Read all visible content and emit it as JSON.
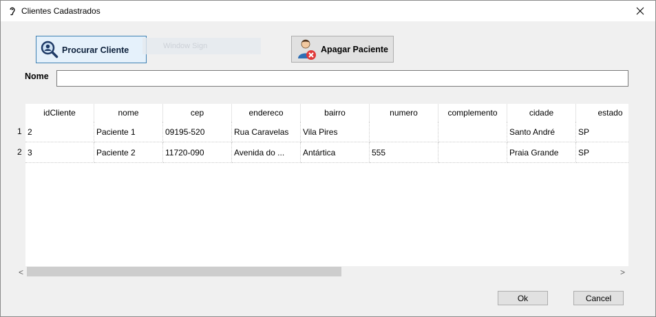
{
  "window": {
    "title": "Clientes Cadastrados"
  },
  "toolbar": {
    "search_label": "Procurar Cliente",
    "ghost_label": "Window Sign",
    "delete_label": "Apagar Paciente"
  },
  "form": {
    "nome_label": "Nome",
    "nome_value": ""
  },
  "table": {
    "columns": [
      "idCliente",
      "nome",
      "cep",
      "endereco",
      "bairro",
      "numero",
      "complemento",
      "cidade",
      "estado"
    ],
    "rows": [
      {
        "num": "1",
        "cells": [
          "2",
          "Paciente 1",
          "09195-520",
          "Rua Caravelas",
          "Vila Pires",
          "",
          "",
          "Santo André",
          "SP"
        ]
      },
      {
        "num": "2",
        "cells": [
          "3",
          "Paciente 2",
          "11720-090",
          "Avenida do ...",
          "Antártica",
          "555",
          "",
          "Praia Grande",
          "SP"
        ]
      }
    ]
  },
  "scroll": {
    "left_arrow": "<",
    "right_arrow": ">"
  },
  "footer": {
    "ok_label": "Ok",
    "cancel_label": "Cancel"
  }
}
